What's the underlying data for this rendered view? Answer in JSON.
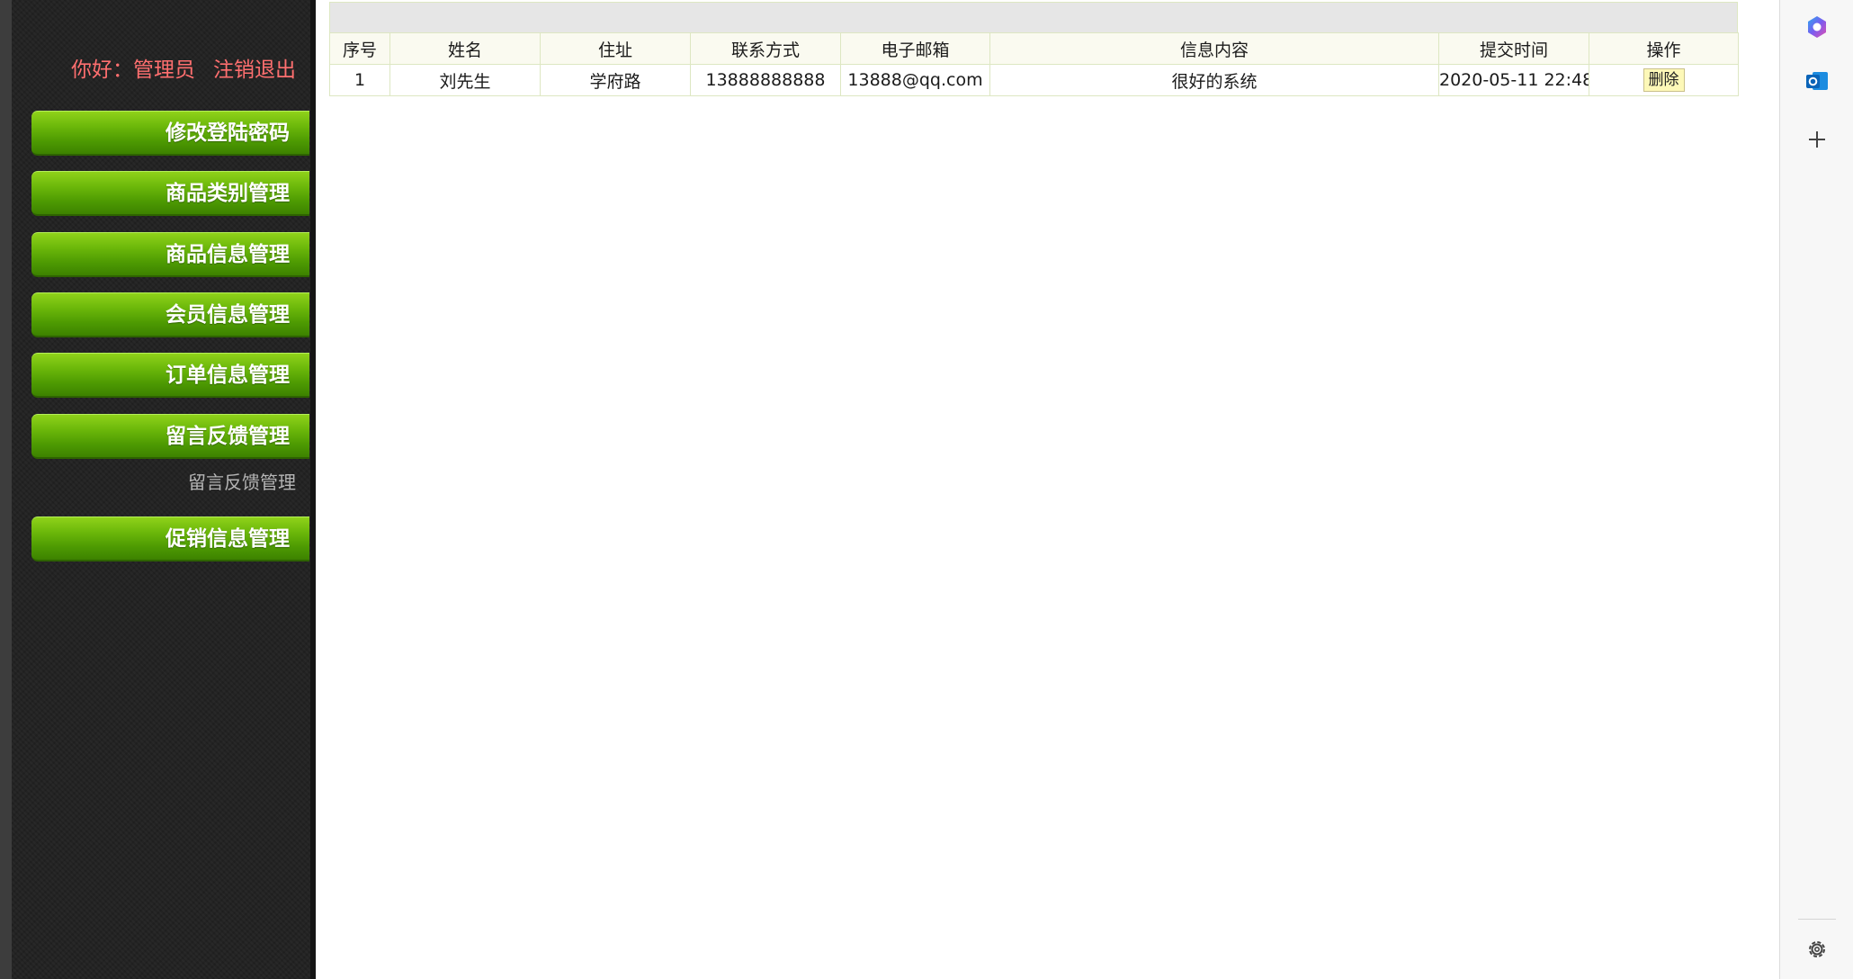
{
  "sidebar": {
    "greeting": "你好：管理员",
    "logout": "注销退出",
    "menu": [
      {
        "label": "修改登陆密码"
      },
      {
        "label": "商品类别管理"
      },
      {
        "label": "商品信息管理"
      },
      {
        "label": "会员信息管理"
      },
      {
        "label": "订单信息管理"
      },
      {
        "label": "留言反馈管理"
      },
      {
        "label": "促销信息管理"
      }
    ],
    "submenu_label": "留言反馈管理"
  },
  "table": {
    "headers": [
      "序号",
      "姓名",
      "住址",
      "联系方式",
      "电子邮箱",
      "信息内容",
      "提交时间",
      "操作"
    ],
    "rows": [
      {
        "index": "1",
        "name": "刘先生",
        "address": "学府路",
        "phone": "13888888888",
        "email": "13888@qq.com",
        "content": "很好的系统",
        "time": "2020-05-11 22:48",
        "action": "删除"
      }
    ]
  },
  "side_panel": {
    "icons": [
      "copilot-icon",
      "outlook-icon",
      "add-icon",
      "settings-icon"
    ]
  },
  "colors": {
    "sidebar_bg": "#232323",
    "menu_green": "#5aa805",
    "greeting_red": "#ff6f6f",
    "table_border": "#dde7c2",
    "delete_button_bg": "#fdf8b8"
  }
}
